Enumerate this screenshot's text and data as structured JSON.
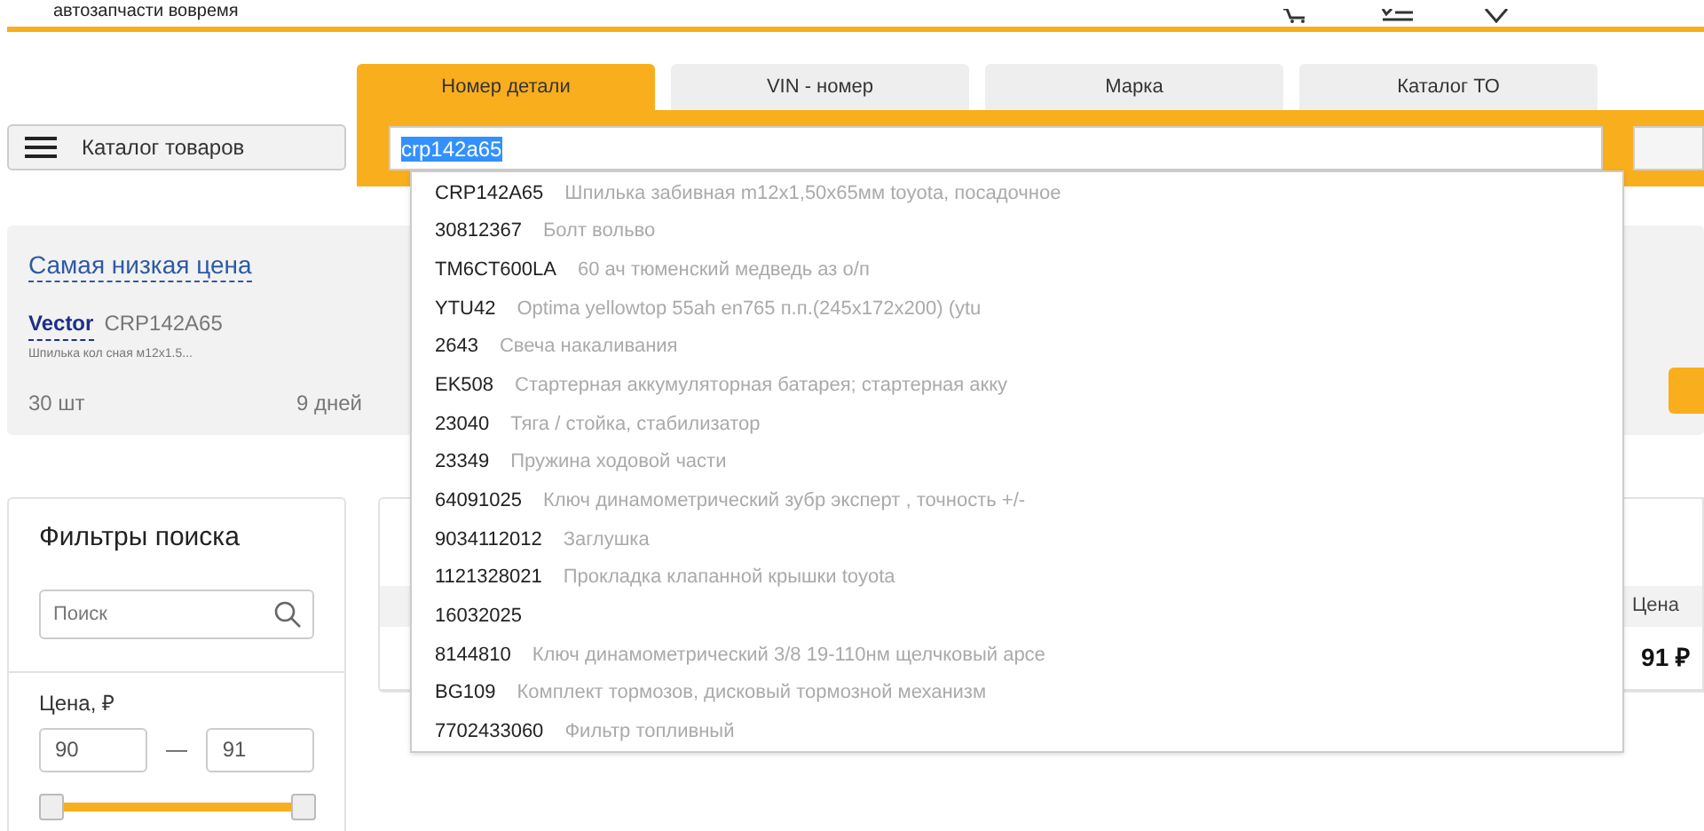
{
  "header": {
    "tagline": "автозапчасти вовремя"
  },
  "catalog_button": {
    "label": "Каталог товаров"
  },
  "search_tabs": [
    {
      "label": "Номер детали",
      "selected": true
    },
    {
      "label": "VIN - номер",
      "selected": false
    },
    {
      "label": "Марка",
      "selected": false
    },
    {
      "label": "Каталог ТО",
      "selected": false
    }
  ],
  "search": {
    "value": "crp142a65",
    "highlighted": true
  },
  "suggestions": [
    {
      "code": "CRP142A65",
      "description": "Шпилька забивная m12x1,50x65мм toyota, посадочное"
    },
    {
      "code": "30812367",
      "description": "Болт вольво"
    },
    {
      "code": "TM6CT600LA",
      "description": "60 ач тюменский медведь аз о/п"
    },
    {
      "code": "YTU42",
      "description": "Optima yellowtop 55ah en765 п.п.(245x172x200) (ytu"
    },
    {
      "code": "2643",
      "description": "Свеча накаливания"
    },
    {
      "code": "EK508",
      "description": "Стартерная аккумуляторная батарея; стартерная акку"
    },
    {
      "code": "23040",
      "description": "Тяга / стойка, стабилизатор"
    },
    {
      "code": "23349",
      "description": "Пружина ходовой части"
    },
    {
      "code": "64091025",
      "description": "Ключ динамометрический зубр эксперт , точность +/-"
    },
    {
      "code": "9034112012",
      "description": "Заглушка"
    },
    {
      "code": "1121328021",
      "description": "Прокладка клапанной крышки toyota"
    },
    {
      "code": "16032025"
    },
    {
      "code": "8144810",
      "description": "Ключ динамометрический 3/8 19-110нм щелчковый арсе"
    },
    {
      "code": "BG109",
      "description": "Комплект тормозов, дисковый тормозной механизм"
    },
    {
      "code": "7702433060",
      "description": "Фильтр топливный"
    }
  ],
  "best_offer": {
    "title": "Самая низкая цена",
    "brand": "Vector",
    "article": "CRP142A65",
    "description": "Шпилька кол сная м12x1.5...",
    "quantity": "30 шт",
    "delivery": "9 дней"
  },
  "filters": {
    "title": "Фильтры поиска",
    "search_placeholder": "Поиск",
    "price_label": "Цена, ₽",
    "price_from": "90",
    "range_separator": "—",
    "price_to": "91",
    "level": 1
  },
  "results": {
    "columns": [
      {
        "label": "Цена"
      }
    ],
    "rows": [
      {
        "price": "91 ₽"
      }
    ]
  }
}
